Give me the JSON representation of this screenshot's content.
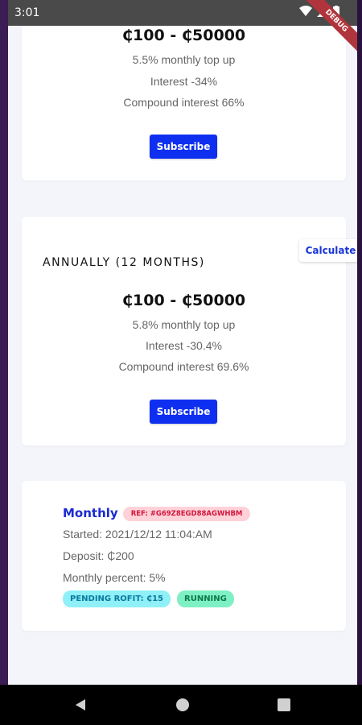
{
  "statusbar": {
    "time": "3:01",
    "debug_label": "DEBUG"
  },
  "plans": [
    {
      "title": "",
      "range": "₵100 - ₵50000",
      "top_up": "5.5% monthly top up",
      "interest": "Interest -34%",
      "compound": "Compound interest 66%",
      "button": "Subscribe"
    },
    {
      "title": "ANNUALLY (12 MONTHS)",
      "range": "₵100 - ₵50000",
      "top_up": "5.8% monthly top up",
      "interest": "Interest -30.4%",
      "compound": "Compound interest 69.6%",
      "button": "Subscribe"
    }
  ],
  "calculate_label": "Calculate",
  "subscription": {
    "type": "Monthly",
    "ref": "REF: #G69Z8EGD88AGWHBM",
    "started": "Started: 2021/12/12 11:04:AM",
    "deposit": "Deposit: ₵200",
    "percent": "Monthly percent: 5%",
    "pending": "PENDING ROFIT: ₵15",
    "status": "RUNNING"
  },
  "colors": {
    "accent": "#0f2ff0",
    "ref_bg": "#ffd1d8",
    "pending_bg": "#8ff0f7",
    "running_bg": "#7ff0c4"
  }
}
